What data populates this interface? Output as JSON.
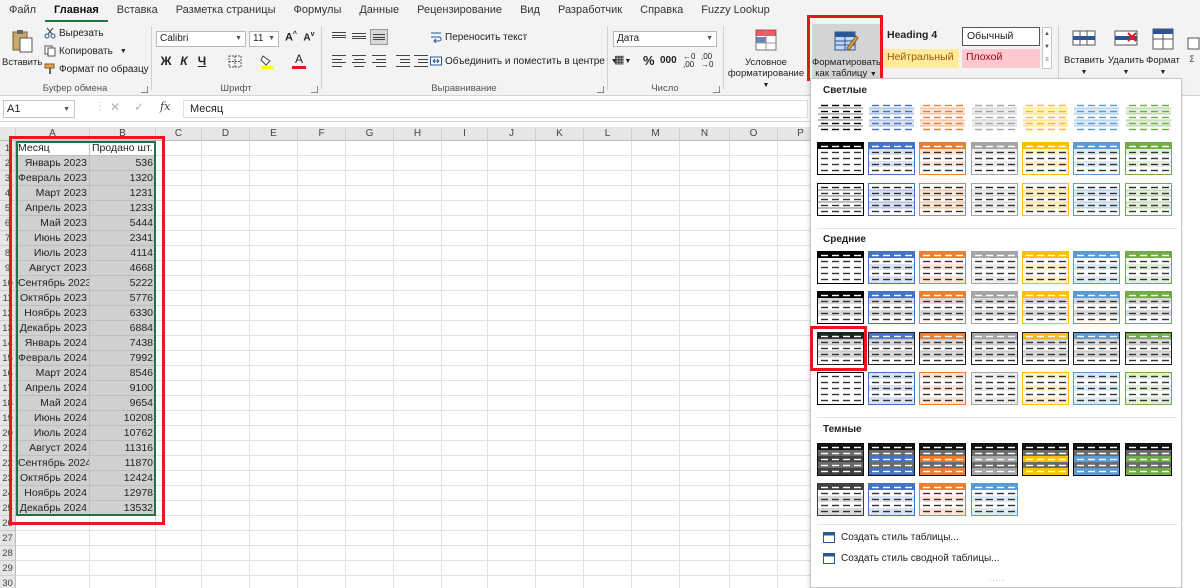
{
  "tabs": [
    "Файл",
    "Главная",
    "Вставка",
    "Разметка страницы",
    "Формулы",
    "Данные",
    "Рецензирование",
    "Вид",
    "Разработчик",
    "Справка",
    "Fuzzy Lookup"
  ],
  "active_tab_index": 1,
  "clipboard": {
    "paste": "Вставить",
    "cut": "Вырезать",
    "copy": "Копировать",
    "format_painter": "Формат по образцу",
    "label": "Буфер обмена"
  },
  "font": {
    "name": "Calibri",
    "size": "11",
    "bold": "Ж",
    "italic": "К",
    "underline": "Ч",
    "label": "Шрифт"
  },
  "alignment": {
    "wrap_text": "Переносить текст",
    "merge_center": "Объединить и поместить в центре",
    "label": "Выравнивание"
  },
  "number": {
    "format": "Дата",
    "label": "Число"
  },
  "styles": {
    "conditional_line1": "Условное",
    "conditional_line2": "форматирование",
    "format_table_line1": "Форматировать",
    "format_table_line2": "как таблицу",
    "heading4": "Heading 4",
    "normal": "Обычный",
    "neutral": "Нейтральный",
    "bad": "Плохой"
  },
  "cells": {
    "insert": "Вставить",
    "delete": "Удалить",
    "format": "Формат"
  },
  "formula_bar": {
    "name_box": "A1",
    "fx": "fx",
    "content": "Месяц"
  },
  "columns": [
    "A",
    "B",
    "C",
    "D",
    "E",
    "F",
    "G",
    "H",
    "I",
    "J",
    "K",
    "L",
    "M",
    "N",
    "O",
    "P"
  ],
  "rows": [
    "1",
    "2",
    "3",
    "4",
    "5",
    "6",
    "7",
    "8",
    "9",
    "10",
    "11",
    "12",
    "13",
    "14",
    "15",
    "16",
    "17",
    "18",
    "19",
    "20",
    "21",
    "22",
    "23",
    "24",
    "25",
    "26",
    "27",
    "28",
    "29",
    "30"
  ],
  "table": {
    "headers": [
      "Месяц",
      "Продано шт."
    ],
    "rows": [
      [
        "Январь 2023",
        "536"
      ],
      [
        "Февраль 2023",
        "1320"
      ],
      [
        "Март 2023",
        "1231"
      ],
      [
        "Апрель 2023",
        "1233"
      ],
      [
        "Май 2023",
        "5444"
      ],
      [
        "Июнь 2023",
        "2341"
      ],
      [
        "Июль 2023",
        "4114"
      ],
      [
        "Август 2023",
        "4668"
      ],
      [
        "Сентябрь 2023",
        "5222"
      ],
      [
        "Октябрь 2023",
        "5776"
      ],
      [
        "Ноябрь 2023",
        "6330"
      ],
      [
        "Декабрь 2023",
        "6884"
      ],
      [
        "Январь 2024",
        "7438"
      ],
      [
        "Февраль 2024",
        "7992"
      ],
      [
        "Март 2024",
        "8546"
      ],
      [
        "Апрель 2024",
        "9100"
      ],
      [
        "Май 2024",
        "9654"
      ],
      [
        "Июнь 2024",
        "10208"
      ],
      [
        "Июль 2024",
        "10762"
      ],
      [
        "Август 2024",
        "11316"
      ],
      [
        "Сентябрь 2024",
        "11870"
      ],
      [
        "Октябрь 2024",
        "12424"
      ],
      [
        "Ноябрь 2024",
        "12978"
      ],
      [
        "Декабрь 2024",
        "13532"
      ]
    ]
  },
  "gallery": {
    "light_title": "Светлые",
    "medium_title": "Средние",
    "dark_title": "Темные",
    "new_table_style": "Создать стиль таблицы...",
    "new_pivot_style": "Создать стиль сводной таблицы...",
    "theme_colors": [
      "#000000",
      "#4472c4",
      "#ed7d31",
      "#a5a5a5",
      "#ffc000",
      "#5b9bd5",
      "#70ad47"
    ],
    "light_tints": [
      "#ffffff",
      "#d9e1f2",
      "#fce4d6",
      "#ededed",
      "#fff2cc",
      "#ddebf7",
      "#e2efda"
    ]
  }
}
